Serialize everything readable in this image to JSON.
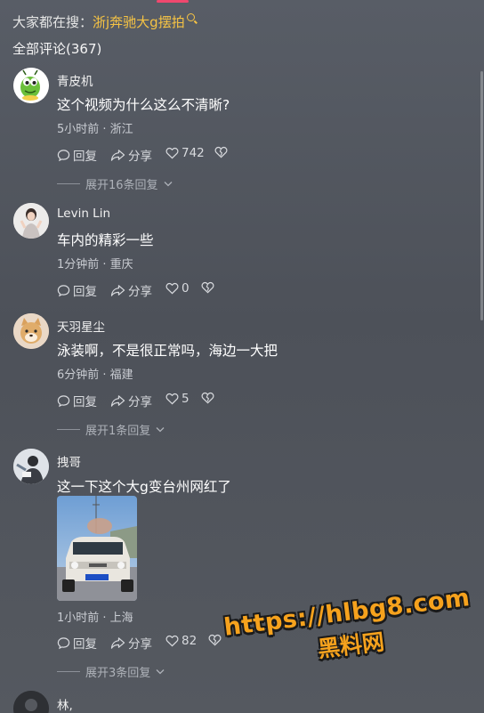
{
  "search": {
    "prefix": "大家都在搜：",
    "keyword": "浙j奔驰大g摆拍"
  },
  "comments_count": "全部评论(367)",
  "comments": [
    {
      "name": "青皮机",
      "text": "这个视频为什么这么不清晰?",
      "meta": "5小时前 · 浙江",
      "reply": "回复",
      "share": "分享",
      "likes": "742",
      "expand": "展开16条回复"
    },
    {
      "name": "Levin Lin",
      "text": "车内的精彩一些",
      "meta": "1分钟前 · 重庆",
      "reply": "回复",
      "share": "分享",
      "likes": "0"
    },
    {
      "name": "天羽星尘",
      "text": "泳装啊，不是很正常吗，海边一大把",
      "meta": "6分钟前 · 福建",
      "reply": "回复",
      "share": "分享",
      "likes": "5",
      "expand": "展开1条回复"
    },
    {
      "name": "拽哥",
      "text": "这一下这个大g变台州网红了",
      "meta": "1小时前 · 上海",
      "reply": "回复",
      "share": "分享",
      "likes": "82",
      "expand": "展开3条回复"
    },
    {
      "name": "林,"
    }
  ],
  "watermark": {
    "url": "https://hlbg8.com",
    "text": "黑料网"
  },
  "colors": {
    "accent": "#f6c344",
    "indicator": "#f0486e",
    "watermark": "#f6a21d"
  }
}
